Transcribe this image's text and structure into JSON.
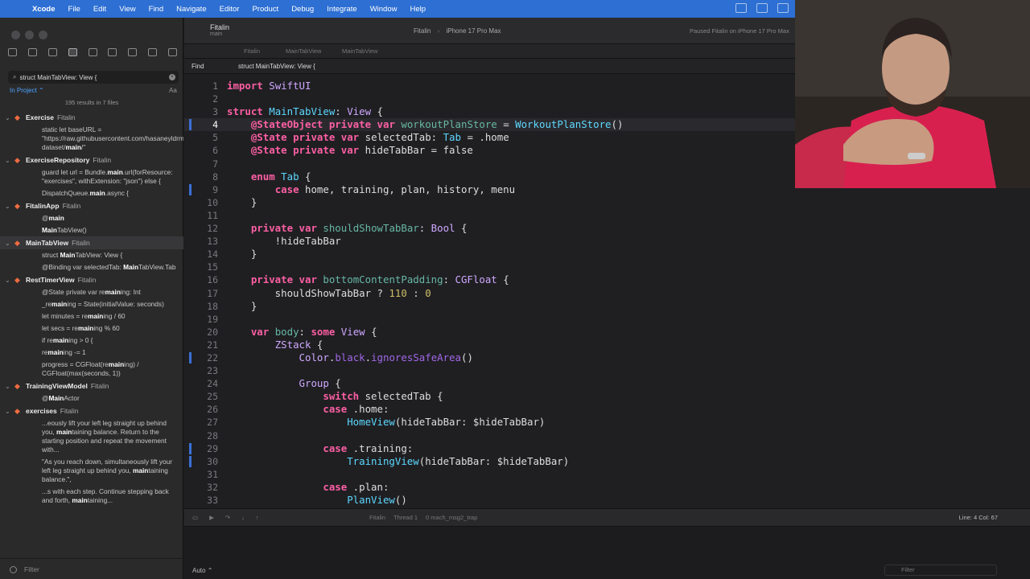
{
  "menubar": {
    "app": "Xcode",
    "items": [
      "File",
      "Edit",
      "View",
      "Find",
      "Navigate",
      "Editor",
      "Product",
      "Debug",
      "Integrate",
      "Window",
      "Help"
    ]
  },
  "sidebar": {
    "search_value": "struct MainTabView: View {",
    "scope": "In Project",
    "aa": "Aa",
    "results": "195 results in 7 files",
    "filter_placeholder": "Filter",
    "groups": [
      {
        "name": "Exercise",
        "module": "Fitalin",
        "results": [
          "static let baseURL = \"https://raw.githubusercontent.com/hasaneyldrm/exercises-dataset/main/\""
        ]
      },
      {
        "name": "ExerciseRepository",
        "module": "Fitalin",
        "results": [
          "guard let url = Bundle.main.url(forResource: \"exercises\", withExtension: \"json\") else {",
          "DispatchQueue.main.async {"
        ]
      },
      {
        "name": "FitalinApp",
        "module": "Fitalin",
        "results": [
          "@main",
          "MainTabView()"
        ]
      },
      {
        "name": "MainTabView",
        "module": "Fitalin",
        "results": [
          "struct MainTabView: View {",
          "@Binding var selectedTab: MainTabView.Tab"
        ]
      },
      {
        "name": "RestTimerView",
        "module": "Fitalin",
        "results": [
          "@State private var remaining: Int",
          "_remaining = State(initialValue: seconds)",
          "let minutes = remaining / 60",
          "let secs = remaining % 60",
          "if remaining > 0 {",
          "remaining -= 1",
          "progress = CGFloat(remaining) / CGFloat(max(seconds, 1))"
        ]
      },
      {
        "name": "TrainingViewModel",
        "module": "Fitalin",
        "results": [
          "@MainActor"
        ]
      },
      {
        "name": "exercises",
        "module": "Fitalin",
        "results": [
          "...eously lift your left leg straight up behind you, maintaining balance. Return to the starting position and repeat the movement with...",
          "\"As you reach down, simultaneously lift your left leg straight up behind you, maintaining balance.\",",
          "...s with each step. Continue stepping back and forth, maintaining..."
        ]
      }
    ]
  },
  "toolbar": {
    "project": "Fitalin",
    "branch": "main",
    "scheme": "Fitalin",
    "destination": "iPhone 17 Pro Max",
    "status": "Paused Fitalin on iPhone 17 Pro Max"
  },
  "jumpbar": {
    "crumbs": [
      "Fitalin",
      "MainTabView",
      "MainTabView"
    ]
  },
  "findbar": {
    "mode": "Find",
    "query": "struct MainTabView: View {"
  },
  "code": {
    "lines": [
      "import SwiftUI",
      "",
      "struct MainTabView: View {",
      "    @StateObject private var workoutPlanStore = WorkoutPlanStore()",
      "    @State private var selectedTab: Tab = .home",
      "    @State private var hideTabBar = false",
      "",
      "    enum Tab {",
      "        case home, training, plan, history, menu",
      "    }",
      "",
      "    private var shouldShowTabBar: Bool {",
      "        !hideTabBar",
      "    }",
      "",
      "    private var bottomContentPadding: CGFloat {",
      "        shouldShowTabBar ? 110 : 0",
      "    }",
      "",
      "    var body: some View {",
      "        ZStack {",
      "            Color.black.ignoresSafeArea()",
      "",
      "            Group {",
      "                switch selectedTab {",
      "                case .home:",
      "                    HomeView(hideTabBar: $hideTabBar)",
      "",
      "                case .training:",
      "                    TrainingView(hideTabBar: $hideTabBar)",
      "",
      "                case .plan:",
      "                    PlanView()"
    ]
  },
  "debugbar": {
    "target": "Fitalin",
    "thread": "Thread 1",
    "frame": "0 mach_msg2_trap",
    "cursor": "Line: 4  Col: 67"
  },
  "console": {
    "mode": "Auto",
    "filter_placeholder": "Filter"
  }
}
